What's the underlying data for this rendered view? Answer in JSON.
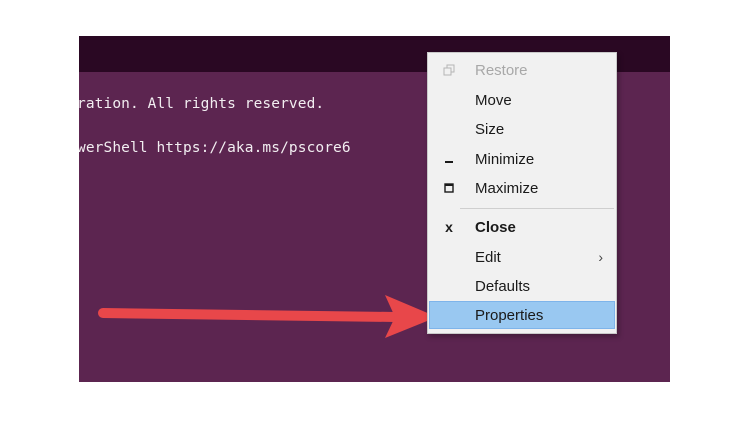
{
  "terminal": {
    "line1": "ration. All rights reserved.",
    "line2": "werShell https://aka.ms/pscore6",
    "background": "#5c2550",
    "titlebar_color": "#2a0823"
  },
  "menu": {
    "items": [
      {
        "label": "Restore",
        "icon": "restore-icon",
        "state": "disabled"
      },
      {
        "label": "Move",
        "icon": "",
        "state": "normal"
      },
      {
        "label": "Size",
        "icon": "",
        "state": "normal"
      },
      {
        "label": "Minimize",
        "icon": "minimize-icon",
        "state": "normal"
      },
      {
        "label": "Maximize",
        "icon": "maximize-icon",
        "state": "normal"
      },
      {
        "label": "Close",
        "icon": "close-icon",
        "state": "bold"
      },
      {
        "label": "Edit",
        "icon": "chevron-right-icon",
        "state": "submenu"
      },
      {
        "label": "Defaults",
        "icon": "",
        "state": "normal"
      },
      {
        "label": "Properties",
        "icon": "",
        "state": "highlighted"
      }
    ],
    "close_glyph": "x",
    "edit_submenu_glyph": "›",
    "highlight_color": "#99c8f1"
  },
  "annotation": {
    "arrow_color": "#e8474a",
    "arrow_icon": "red-arrow-icon"
  }
}
